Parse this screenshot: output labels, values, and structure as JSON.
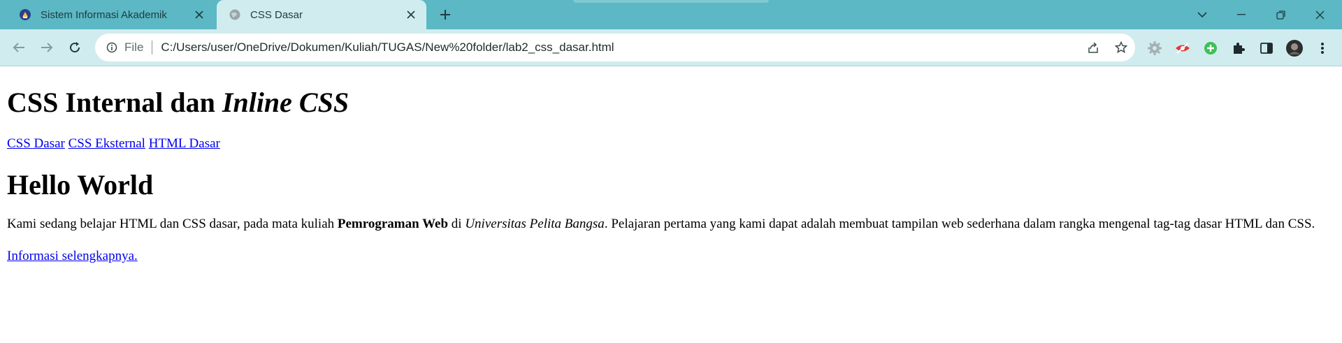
{
  "browser": {
    "tabs": [
      {
        "title": "Sistem Informasi Akademik",
        "active": false,
        "favicon": "university-logo-icon"
      },
      {
        "title": "CSS Dasar",
        "active": true,
        "favicon": "globe-icon"
      }
    ],
    "address": {
      "scheme": "File",
      "url": "C:/Users/user/OneDrive/Dokumen/Kuliah/TUGAS/New%20folder/lab2_css_dasar.html"
    },
    "colors": {
      "tabbar": "#5bb8c4",
      "toolbar": "#d0ecef"
    }
  },
  "page": {
    "title_plain": "CSS Internal dan ",
    "title_italic": "Inline CSS",
    "nav_links": [
      "CSS Dasar",
      "CSS Eksternal",
      "HTML Dasar"
    ],
    "heading": "Hello World",
    "paragraph": {
      "part1": "Kami sedang belajar HTML dan CSS dasar, pada mata kuliah ",
      "bold": "Pemrograman Web",
      "part2": " di ",
      "italic": "Universitas Pelita Bangsa",
      "part3": ". Pelajaran pertama yang kami dapat adalah membuat tampilan web sederhana dalam rangka mengenal tag-tag dasar HTML dan CSS."
    },
    "more_link": "Informasi selengkapnya."
  }
}
